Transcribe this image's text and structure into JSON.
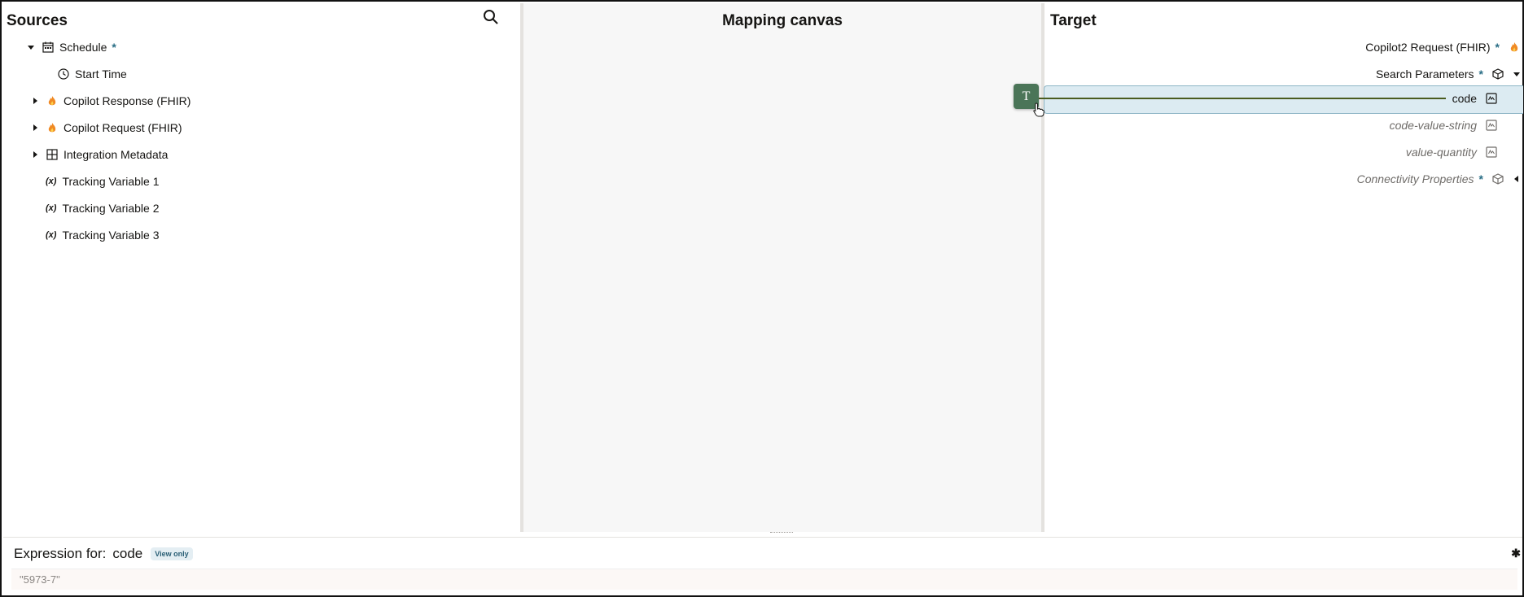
{
  "sources": {
    "title": "Sources",
    "items": [
      {
        "label": "Schedule",
        "required": "*"
      },
      {
        "label": "Start Time"
      },
      {
        "label": "Copilot Response (FHIR)"
      },
      {
        "label": "Copilot Request (FHIR)"
      },
      {
        "label": "Integration Metadata"
      },
      {
        "label": "Tracking Variable 1",
        "icon_text": "(x)"
      },
      {
        "label": "Tracking Variable 2",
        "icon_text": "(x)"
      },
      {
        "label": "Tracking Variable 3",
        "icon_text": "(x)"
      }
    ]
  },
  "canvas": {
    "title": "Mapping canvas",
    "function_node": "T"
  },
  "target": {
    "title": "Target",
    "items": [
      {
        "label": "Copilot2 Request (FHIR)",
        "required": "*"
      },
      {
        "label": "Search Parameters",
        "required": "*"
      },
      {
        "label": "code"
      },
      {
        "label": "code-value-string"
      },
      {
        "label": "value-quantity"
      },
      {
        "label": "Connectivity Properties",
        "required": "*"
      }
    ]
  },
  "expression": {
    "label": "Expression for:",
    "field": "code",
    "badge": "View only",
    "value": "\"5973-7\"",
    "close": "✱"
  },
  "colors": {
    "accent": "#2a6e86",
    "node": "#4b7558",
    "highlight": "#dcebf2",
    "fire": "#f08a24"
  }
}
